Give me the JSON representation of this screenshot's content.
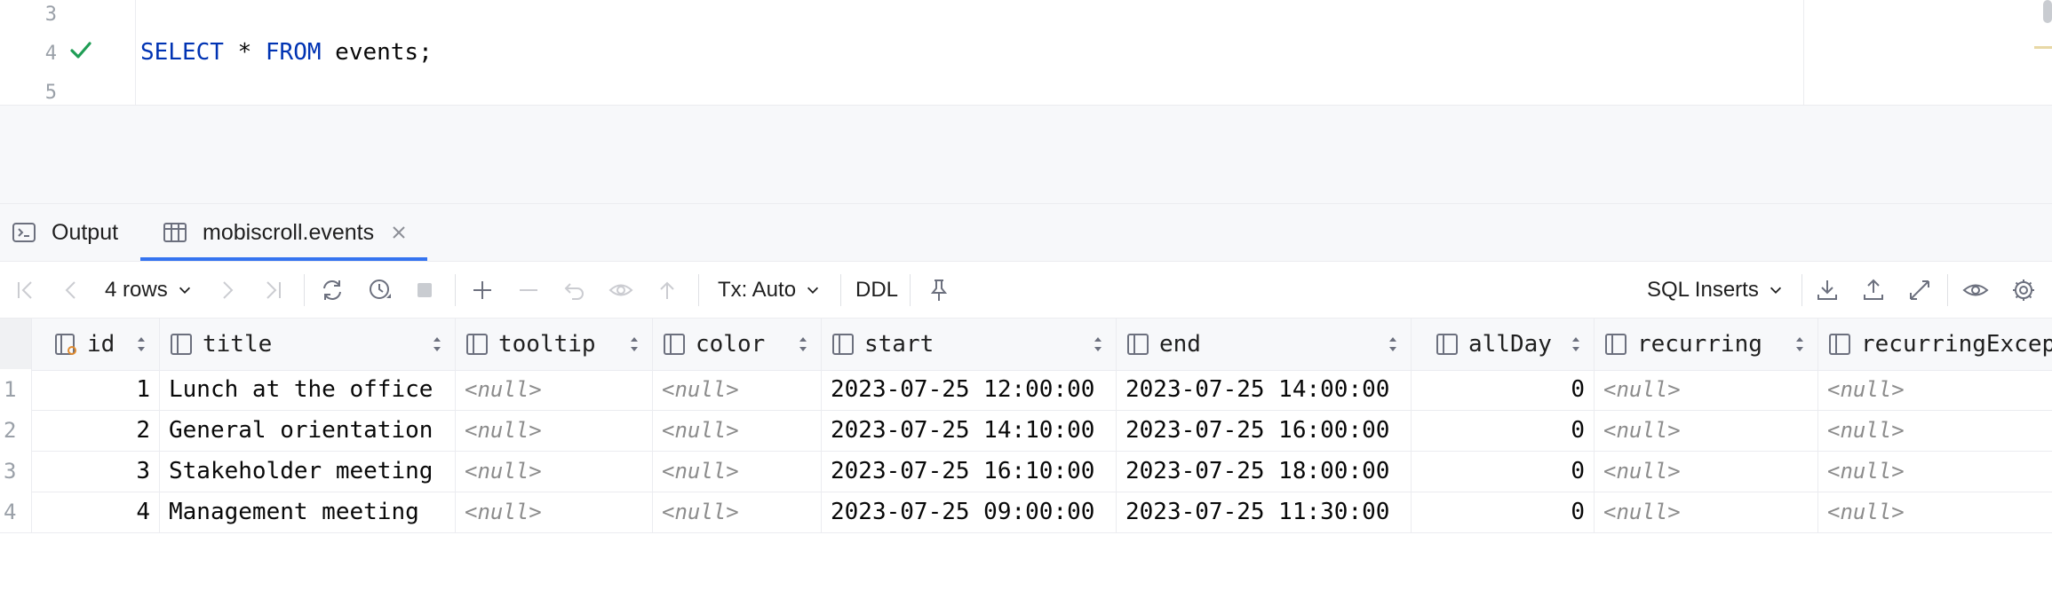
{
  "editor": {
    "lines": [
      {
        "number": "3",
        "text": ""
      },
      {
        "number": "4",
        "keyword1": "SELECT",
        "middle": " * ",
        "keyword2": "FROM",
        "rest": " events;"
      },
      {
        "number": "5",
        "text": ""
      }
    ],
    "status_icon": "checkmark-icon"
  },
  "tabs": [
    {
      "label": "Output",
      "icon": "console-icon"
    },
    {
      "label": "mobiscroll.events",
      "icon": "table-icon",
      "close_icon": "close-icon"
    }
  ],
  "toolbar": {
    "rows_label": "4 rows",
    "tx_label": "Tx: Auto",
    "ddl_label": "DDL",
    "format_label": "SQL Inserts"
  },
  "grid": {
    "columns": [
      "id",
      "title",
      "tooltip",
      "color",
      "start",
      "end",
      "allDay",
      "recurring",
      "recurringExcep"
    ],
    "rows": [
      {
        "n": "1",
        "id": "1",
        "title": "Lunch at the office",
        "tooltip": "<null>",
        "color": "<null>",
        "start": "2023-07-25 12:00:00",
        "end": "2023-07-25 14:00:00",
        "allDay": "0",
        "recurring": "<null>",
        "recurringException": "<null>"
      },
      {
        "n": "2",
        "id": "2",
        "title": "General orientation",
        "tooltip": "<null>",
        "color": "<null>",
        "start": "2023-07-25 14:10:00",
        "end": "2023-07-25 16:00:00",
        "allDay": "0",
        "recurring": "<null>",
        "recurringException": "<null>"
      },
      {
        "n": "3",
        "id": "3",
        "title": "Stakeholder meeting",
        "tooltip": "<null>",
        "color": "<null>",
        "start": "2023-07-25 16:10:00",
        "end": "2023-07-25 18:00:00",
        "allDay": "0",
        "recurring": "<null>",
        "recurringException": "<null>"
      },
      {
        "n": "4",
        "id": "4",
        "title": "Management meeting",
        "tooltip": "<null>",
        "color": "<null>",
        "start": "2023-07-25 09:00:00",
        "end": "2023-07-25 11:30:00",
        "allDay": "0",
        "recurring": "<null>",
        "recurringException": "<null>"
      }
    ]
  },
  "colors": {
    "accent": "#3574f0",
    "keyword": "#0033b3",
    "success": "#1f9d55",
    "null_text": "#8c8c8c"
  }
}
